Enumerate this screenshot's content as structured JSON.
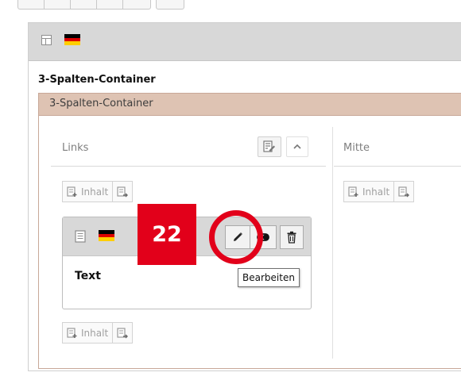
{
  "header": {
    "page_icon": "page-layout-icon",
    "language_flag": {
      "name": "flag-de-icon",
      "colors": [
        "#000000",
        "#dd0000",
        "#ffce00"
      ]
    }
  },
  "section": {
    "title": "3-Spalten-Container"
  },
  "container": {
    "title": "3-Spalten-Container",
    "accent": "#dec3b3",
    "columns": [
      {
        "title": "Links",
        "edit_icon": "edit-column-icon",
        "collapse_icon": "chevron-up-icon"
      },
      {
        "title": "Mitte"
      }
    ],
    "new_content_label": "Inhalt",
    "new_content_icon": "new-content-icon",
    "paste_icon": "paste-content-icon"
  },
  "element": {
    "title": "Text",
    "type_icon": "text-content-icon",
    "actions": {
      "edit_icon": "pencil-icon",
      "toggle_icon": "toggle-visibility-icon",
      "delete_icon": "trash-icon"
    },
    "tooltip": "Bearbeiten"
  },
  "annotation": {
    "number": "22",
    "color": "#e2001a"
  }
}
